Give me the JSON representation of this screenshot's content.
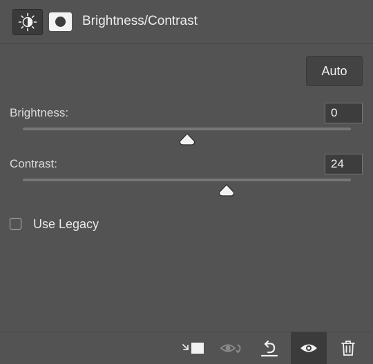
{
  "header": {
    "title": "Brightness/Contrast",
    "adjustment_icon": "brightness-contrast-icon",
    "mask_icon": "layer-mask-icon"
  },
  "auto_button": {
    "label": "Auto"
  },
  "brightness": {
    "label": "Brightness:",
    "value": "0",
    "slider_fraction": 0.5
  },
  "contrast": {
    "label": "Contrast:",
    "value": "24",
    "slider_fraction": 0.62
  },
  "legacy": {
    "label": "Use Legacy",
    "checked": false
  },
  "footer": {
    "icons": [
      "clip-to-layer-icon",
      "view-previous-state-icon",
      "reset-icon",
      "visibility-eye-icon",
      "trash-icon"
    ]
  },
  "colors": {
    "panel_bg": "#535353",
    "field_bg": "#3d3d3d",
    "track": "#777777",
    "text": "#e6e6e6"
  }
}
